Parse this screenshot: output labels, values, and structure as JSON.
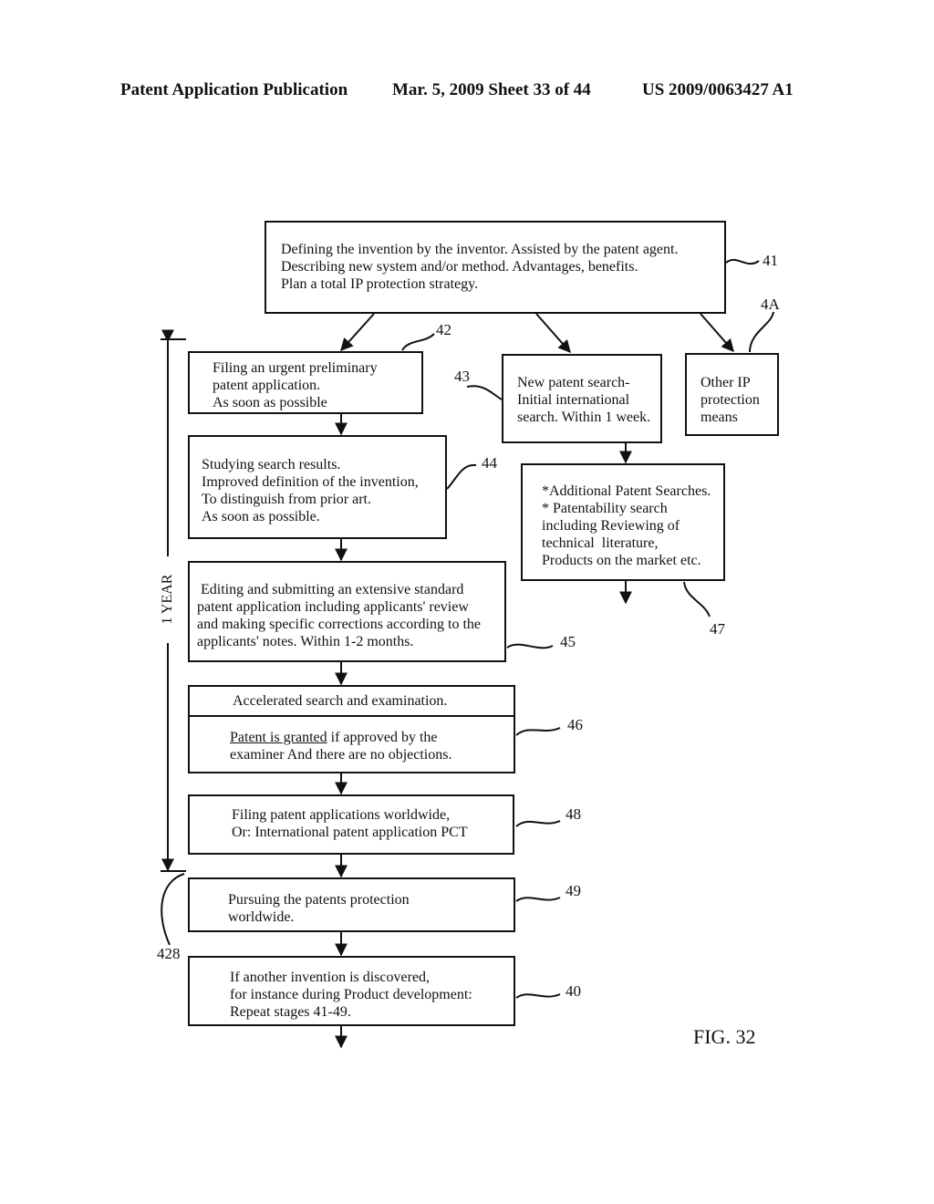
{
  "header": {
    "left": "Patent Application Publication",
    "date_sheet": "Mar. 5, 2009   Sheet 33 of 44",
    "pub_number": "US 2009/0063427 A1"
  },
  "figure_label": "FIG. 32",
  "timeline": {
    "label": "1 YEAR"
  },
  "steps": {
    "s41": {
      "ref": "41",
      "lines": [
        "Defining the invention by the inventor. Assisted by the patent agent.",
        "Describing new system and/or method. Advantages, benefits.",
        "Plan a total IP protection strategy."
      ]
    },
    "s42": {
      "ref": "42",
      "lines": [
        "Filing an urgent preliminary",
        "patent application.",
        "As soon as possible"
      ]
    },
    "s43": {
      "ref": "43",
      "lines": [
        "New patent search-",
        "Initial international",
        "search. Within 1 week."
      ]
    },
    "s4A": {
      "ref": "4A",
      "lines": [
        "Other IP",
        "protection",
        "means"
      ]
    },
    "s44": {
      "ref": "44",
      "lines": [
        "Studying search results.",
        "Improved definition of the invention,",
        "To distinguish from prior art.",
        "As soon as possible."
      ]
    },
    "s47": {
      "ref": "47",
      "lines": [
        "*Additional Patent Searches.",
        "* Patentability search",
        "including Reviewing of",
        "technical  literature,",
        "Products on the market etc."
      ]
    },
    "s45": {
      "ref": "45",
      "lines": [
        " Editing and submitting an extensive standard",
        "patent application including applicants' review",
        "and making specific corrections according to the",
        "applicants' notes. Within 1-2 months."
      ]
    },
    "s46": {
      "ref": "46",
      "header": "Accelerated search and examination.",
      "underlined": "Patent is granted",
      "line1_rest": " if approved by the",
      "line2": "examiner And there are no objections."
    },
    "s48": {
      "ref": "48",
      "lines": [
        "Filing patent applications worldwide,",
        "Or: International patent application PCT"
      ]
    },
    "s49": {
      "ref": "49",
      "lines": [
        "Pursuing the patents protection",
        "worldwide."
      ]
    },
    "s40": {
      "ref": "40",
      "lines": [
        "If another invention is discovered,",
        "for instance during Product development:",
        "Repeat stages 41-49."
      ]
    },
    "s428": {
      "ref": "428"
    }
  }
}
